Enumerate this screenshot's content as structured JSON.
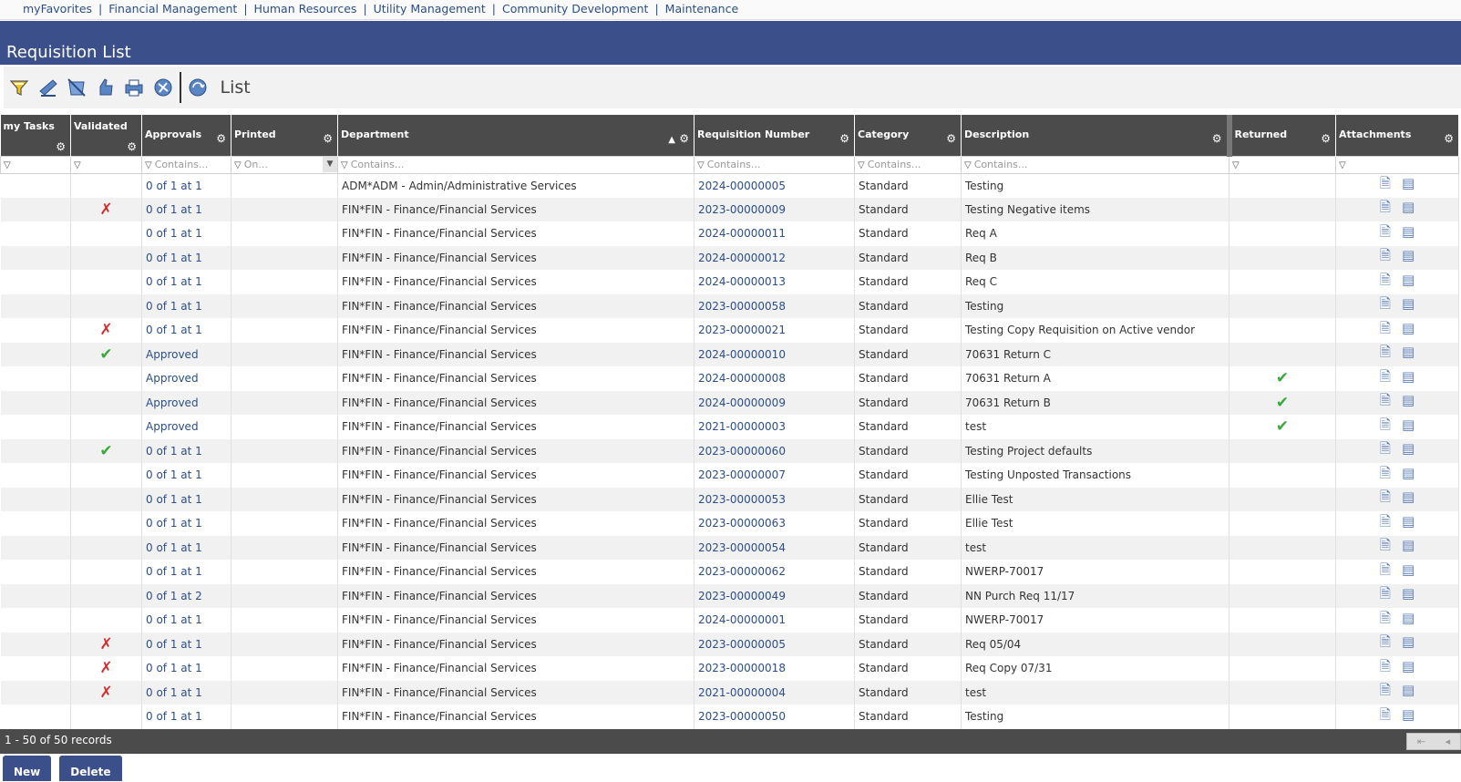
{
  "topnav": [
    "myFavorites",
    "Financial Management",
    "Human Resources",
    "Utility Management",
    "Community Development",
    "Maintenance"
  ],
  "title": "Requisition List",
  "toolbar": {
    "icons": [
      "search-icon",
      "check-icon",
      "no-check-icon",
      "thumbs-icon",
      "print-icon",
      "refresh-icon",
      "refresh-icon"
    ],
    "view_label": "List"
  },
  "columns": {
    "my_tasks": "my Tasks",
    "validated": "Validated",
    "approvals": "Approvals",
    "printed": "Printed",
    "department": "Department",
    "req_number": "Requisition Number",
    "category": "Category",
    "description": "Description",
    "returned": "Returned",
    "attachments": "Attachments"
  },
  "filters": {
    "approvals": "Contains...",
    "printed": "On...",
    "department": "Contains...",
    "req_number": "Contains...",
    "category": "Contains...",
    "description": "Contains..."
  },
  "rows": [
    {
      "validated": "",
      "approvals": "0 of 1 at 1",
      "department": "ADM*ADM - Admin/Administrative Services",
      "req": "2024-00000005",
      "category": "Standard",
      "description": "Testing",
      "returned": ""
    },
    {
      "validated": "x",
      "approvals": "0 of 1 at 1",
      "department": "FIN*FIN - Finance/Financial Services",
      "req": "2023-00000009",
      "category": "Standard",
      "description": "Testing Negative items",
      "returned": ""
    },
    {
      "validated": "",
      "approvals": "0 of 1 at 1",
      "department": "FIN*FIN - Finance/Financial Services",
      "req": "2024-00000011",
      "category": "Standard",
      "description": "Req A",
      "returned": ""
    },
    {
      "validated": "",
      "approvals": "0 of 1 at 1",
      "department": "FIN*FIN - Finance/Financial Services",
      "req": "2024-00000012",
      "category": "Standard",
      "description": "Req B",
      "returned": ""
    },
    {
      "validated": "",
      "approvals": "0 of 1 at 1",
      "department": "FIN*FIN - Finance/Financial Services",
      "req": "2024-00000013",
      "category": "Standard",
      "description": "Req C",
      "returned": ""
    },
    {
      "validated": "",
      "approvals": "0 of 1 at 1",
      "department": "FIN*FIN - Finance/Financial Services",
      "req": "2023-00000058",
      "category": "Standard",
      "description": "Testing",
      "returned": ""
    },
    {
      "validated": "x",
      "approvals": "0 of 1 at 1",
      "department": "FIN*FIN - Finance/Financial Services",
      "req": "2023-00000021",
      "category": "Standard",
      "description": "Testing Copy Requisition on Active vendor",
      "returned": ""
    },
    {
      "validated": "check",
      "approvals": "Approved",
      "department": "FIN*FIN - Finance/Financial Services",
      "req": "2024-00000010",
      "category": "Standard",
      "description": "70631 Return C",
      "returned": ""
    },
    {
      "validated": "",
      "approvals": "Approved",
      "department": "FIN*FIN - Finance/Financial Services",
      "req": "2024-00000008",
      "category": "Standard",
      "description": "70631 Return A",
      "returned": "check"
    },
    {
      "validated": "",
      "approvals": "Approved",
      "department": "FIN*FIN - Finance/Financial Services",
      "req": "2024-00000009",
      "category": "Standard",
      "description": "70631 Return B",
      "returned": "check"
    },
    {
      "validated": "",
      "approvals": "Approved",
      "department": "FIN*FIN - Finance/Financial Services",
      "req": "2021-00000003",
      "category": "Standard",
      "description": "test",
      "returned": "check"
    },
    {
      "validated": "check",
      "approvals": "0 of 1 at 1",
      "department": "FIN*FIN - Finance/Financial Services",
      "req": "2023-00000060",
      "category": "Standard",
      "description": "Testing Project defaults",
      "returned": ""
    },
    {
      "validated": "",
      "approvals": "0 of 1 at 1",
      "department": "FIN*FIN - Finance/Financial Services",
      "req": "2023-00000007",
      "category": "Standard",
      "description": "Testing Unposted Transactions",
      "returned": ""
    },
    {
      "validated": "",
      "approvals": "0 of 1 at 1",
      "department": "FIN*FIN - Finance/Financial Services",
      "req": "2023-00000053",
      "category": "Standard",
      "description": "Ellie Test",
      "returned": ""
    },
    {
      "validated": "",
      "approvals": "0 of 1 at 1",
      "department": "FIN*FIN - Finance/Financial Services",
      "req": "2023-00000063",
      "category": "Standard",
      "description": "Ellie Test",
      "returned": ""
    },
    {
      "validated": "",
      "approvals": "0 of 1 at 1",
      "department": "FIN*FIN - Finance/Financial Services",
      "req": "2023-00000054",
      "category": "Standard",
      "description": "test",
      "returned": ""
    },
    {
      "validated": "",
      "approvals": "0 of 1 at 1",
      "department": "FIN*FIN - Finance/Financial Services",
      "req": "2023-00000062",
      "category": "Standard",
      "description": "NWERP-70017",
      "returned": ""
    },
    {
      "validated": "",
      "approvals": "0 of 1 at 2",
      "department": "FIN*FIN - Finance/Financial Services",
      "req": "2023-00000049",
      "category": "Standard",
      "description": "NN Purch Req 11/17",
      "returned": ""
    },
    {
      "validated": "",
      "approvals": "0 of 1 at 1",
      "department": "FIN*FIN - Finance/Financial Services",
      "req": "2024-00000001",
      "category": "Standard",
      "description": "NWERP-70017",
      "returned": ""
    },
    {
      "validated": "x",
      "approvals": "0 of 1 at 1",
      "department": "FIN*FIN - Finance/Financial Services",
      "req": "2023-00000005",
      "category": "Standard",
      "description": "Req 05/04",
      "returned": ""
    },
    {
      "validated": "x",
      "approvals": "0 of 1 at 1",
      "department": "FIN*FIN - Finance/Financial Services",
      "req": "2023-00000018",
      "category": "Standard",
      "description": "Req Copy 07/31",
      "returned": ""
    },
    {
      "validated": "x",
      "approvals": "0 of 1 at 1",
      "department": "FIN*FIN - Finance/Financial Services",
      "req": "2021-00000004",
      "category": "Standard",
      "description": "test",
      "returned": ""
    },
    {
      "validated": "",
      "approvals": "0 of 1 at 1",
      "department": "FIN*FIN - Finance/Financial Services",
      "req": "2023-00000050",
      "category": "Standard",
      "description": "Testing",
      "returned": ""
    }
  ],
  "footer": {
    "records": "1 - 50 of 50 records"
  },
  "buttons": {
    "new": "New",
    "delete": "Delete"
  }
}
